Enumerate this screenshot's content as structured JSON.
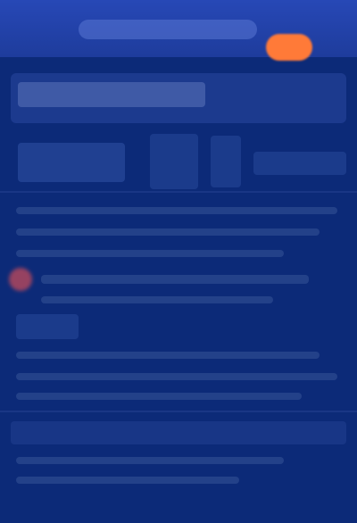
{
  "header": {
    "address_bar_value": "",
    "badge_label": ""
  },
  "page": {
    "title": "",
    "content_lines": []
  }
}
